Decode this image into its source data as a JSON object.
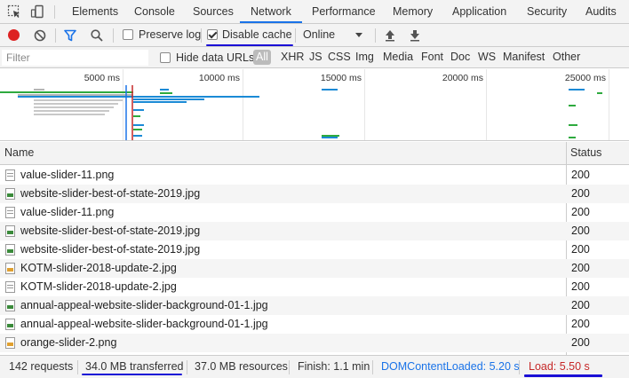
{
  "tabs": {
    "items": [
      "Elements",
      "Console",
      "Sources",
      "Network",
      "Performance",
      "Memory",
      "Application",
      "Security",
      "Audits"
    ],
    "active": "Network"
  },
  "toolbar": {
    "preserve_log": "Preserve log",
    "preserve_log_checked": false,
    "disable_cache": "Disable cache",
    "disable_cache_checked": true,
    "throttle": "Online"
  },
  "filterbar": {
    "placeholder": "Filter",
    "hide_data_urls": "Hide data URLs",
    "types": [
      "All",
      "XHR",
      "JS",
      "CSS",
      "Img",
      "Media",
      "Font",
      "Doc",
      "WS",
      "Manifest",
      "Other"
    ],
    "active_type": "All"
  },
  "overview": {
    "ticks": [
      "5000 ms",
      "10000 ms",
      "15000 ms",
      "20000 ms",
      "25000 ms"
    ]
  },
  "table": {
    "columns": {
      "name": "Name",
      "status": "Status"
    },
    "rows": [
      {
        "name": "value-slider-11.png",
        "status": "200",
        "icon": "png"
      },
      {
        "name": "website-slider-best-of-state-2019.jpg",
        "status": "200",
        "icon": "img"
      },
      {
        "name": "value-slider-11.png",
        "status": "200",
        "icon": "png"
      },
      {
        "name": "website-slider-best-of-state-2019.jpg",
        "status": "200",
        "icon": "img"
      },
      {
        "name": "website-slider-best-of-state-2019.jpg",
        "status": "200",
        "icon": "img"
      },
      {
        "name": "KOTM-slider-2018-update-2.jpg",
        "status": "200",
        "icon": "orange"
      },
      {
        "name": "KOTM-slider-2018-update-2.jpg",
        "status": "200",
        "icon": "png"
      },
      {
        "name": "annual-appeal-website-slider-background-01-1.jpg",
        "status": "200",
        "icon": "img"
      },
      {
        "name": "annual-appeal-website-slider-background-01-1.jpg",
        "status": "200",
        "icon": "img"
      },
      {
        "name": "orange-slider-2.png",
        "status": "200",
        "icon": "orange"
      }
    ]
  },
  "statusbar": {
    "requests": "142 requests",
    "transferred": "34.0 MB transferred",
    "resources": "37.0 MB resources",
    "finish": "Finish: 1.1 min",
    "dom_content_loaded": "DOMContentLoaded: 5.20 s",
    "load": "Load: 5.50 s"
  },
  "colors": {
    "record": "#dd2222",
    "dom_content_loaded": "#1a73e8",
    "load": "#c62828",
    "annotation": "#1a0fd6",
    "accent": "#1a73e8"
  }
}
